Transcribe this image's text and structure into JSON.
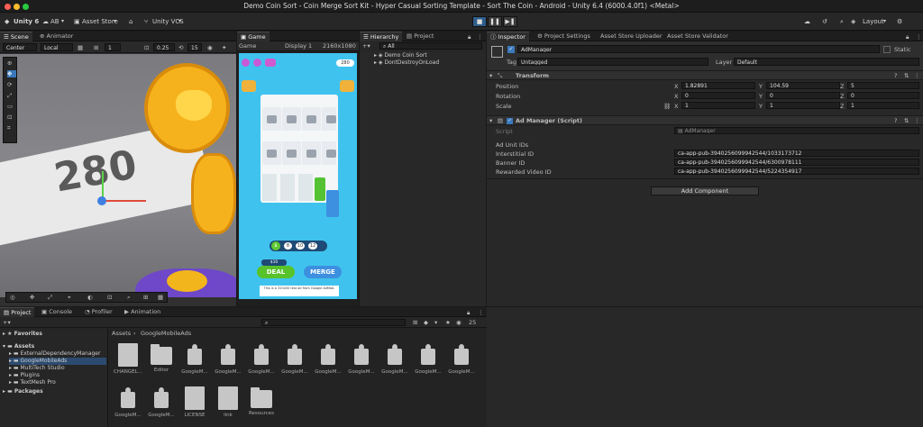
{
  "window": {
    "title": "Demo Coin Sort - Coin Merge Sort Kit - Hyper Casual Sorting Template - Sort The Coin - Android - Unity 6.4 (6000.4.0f1) <Metal>"
  },
  "toolbar": {
    "unity": "Unity 6",
    "account": "AB",
    "asset_store": "Asset Store",
    "vcs": "Unity VCS",
    "layout": "Layout"
  },
  "scene": {
    "tabs": [
      "Scene",
      "Animator"
    ],
    "center": "Center",
    "local": "Local",
    "grid_size": "1",
    "snap_value": "0.25",
    "number_15": "15",
    "coin_text": "280"
  },
  "game": {
    "tab": "Game",
    "mode": "Game",
    "display": "Display 1",
    "resolution": "2160x1080",
    "coin_count": "280",
    "values": [
      "8",
      "10",
      "12"
    ],
    "deal": "DEAL",
    "merge": "MERGE",
    "deal_cost": "$10",
    "ad_text": "This is a 320x50 test ad from Google AdMob."
  },
  "hierarchy": {
    "tabs": [
      "Hierarchy",
      "Project"
    ],
    "search_placeholder": "All",
    "items": [
      "Demo Coin Sort",
      "DontDestroyOnLoad"
    ]
  },
  "inspector": {
    "tabs": [
      "Inspector",
      "Project Settings",
      "Asset Store Uploader",
      "Asset Store Validator"
    ],
    "object_name": "AdManager",
    "static": "Static",
    "tag_label": "Tag",
    "tag_value": "Untagged",
    "layer_label": "Layer",
    "layer_value": "Default",
    "transform": {
      "title": "Transform",
      "rows": [
        {
          "label": "Position",
          "x": "1.82891",
          "y": "104.59",
          "z": "5"
        },
        {
          "label": "Rotation",
          "x": "0",
          "y": "0",
          "z": "0"
        },
        {
          "label": "Scale",
          "x": "1",
          "y": "1",
          "z": "1"
        }
      ]
    },
    "script": {
      "title": "Ad Manager (Script)",
      "script_label": "Script",
      "script_value": "AdManager",
      "section": "Ad Unit IDs",
      "rows": [
        {
          "label": "Interstitial ID",
          "value": "ca-app-pub-3940256099942544/1033173712"
        },
        {
          "label": "Banner ID",
          "value": "ca-app-pub-3940256099942544/6300978111"
        },
        {
          "label": "Rewarded Video ID",
          "value": "ca-app-pub-3940256099942544/5224354917"
        }
      ]
    },
    "add_component": "Add Component"
  },
  "bottom": {
    "tabs": [
      "Project",
      "Console",
      "Profiler",
      "Animation"
    ],
    "count": "25",
    "breadcrumb": [
      "Assets",
      "GoogleMobileAds"
    ],
    "tree": {
      "favorites": "Favorites",
      "assets": "Assets",
      "assets_children": [
        "ExternalDependencyManager",
        "GoogleMobileAds",
        "MultiTech Studio",
        "Plugins",
        "TextMesh Pro"
      ],
      "packages": "Packages"
    },
    "assets_row1": [
      "CHANGEL...",
      "Editor",
      "GoogleM...",
      "GoogleM...",
      "GoogleM...",
      "GoogleM...",
      "GoogleM...",
      "GoogleM...",
      "GoogleM...",
      "GoogleM...",
      "GoogleM..."
    ],
    "assets_row2": [
      "GoogleM...",
      "GoogleM...",
      "LICENSE",
      "link",
      "Resources"
    ]
  },
  "colors": {
    "accent": "#3a79bb",
    "coin": "#f4b61c",
    "game_bg": "#3fc3ee",
    "deal": "#58c22a",
    "merge": "#3d8fe0"
  }
}
